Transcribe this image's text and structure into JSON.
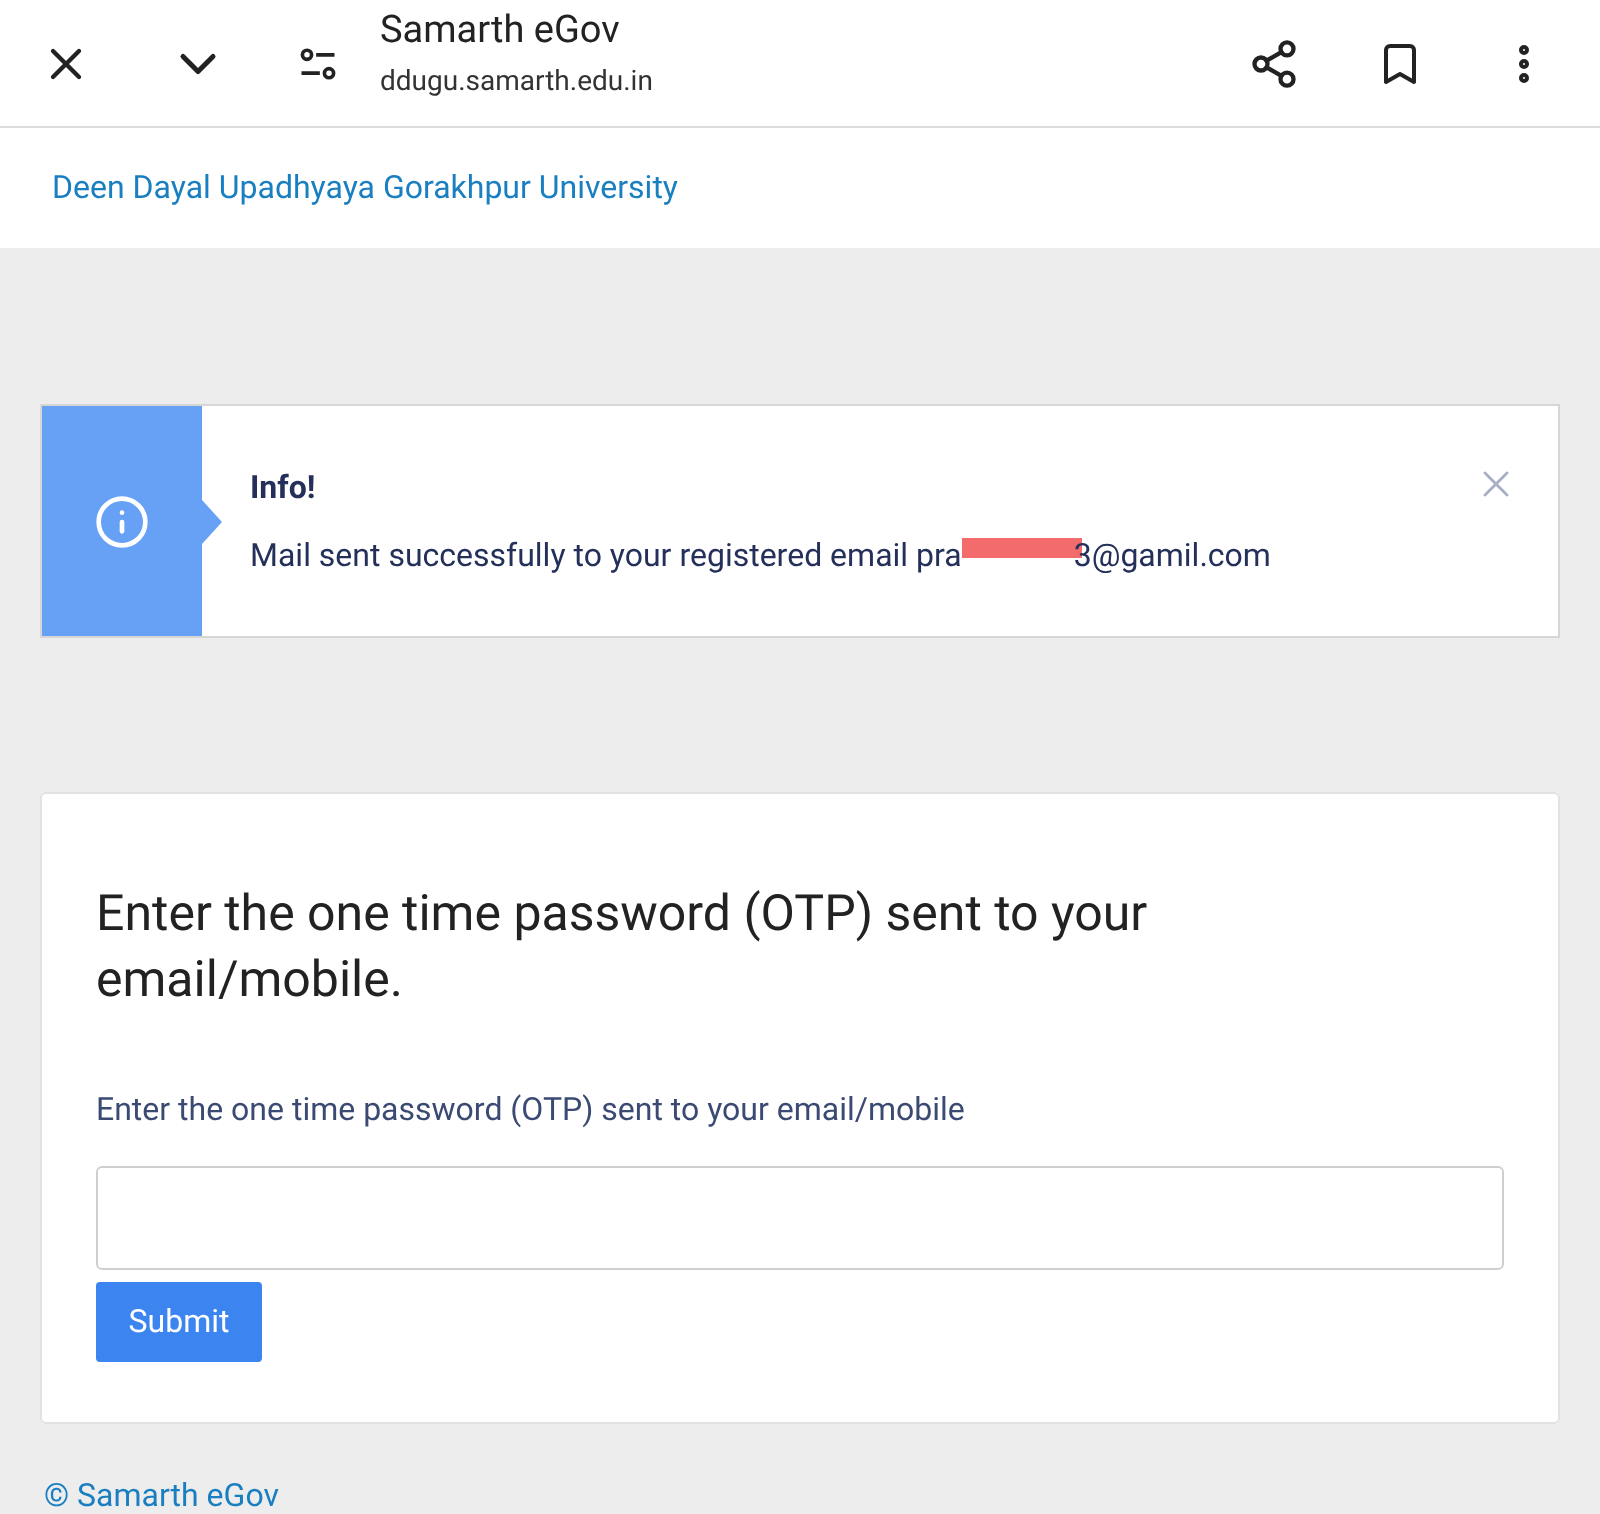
{
  "browser_bar": {
    "title": "Samarth eGov",
    "url": "ddugu.samarth.edu.in"
  },
  "header": {
    "link": "Deen Dayal Upadhyaya Gorakhpur University"
  },
  "alert": {
    "title": "Info!",
    "message_start": "Mail sent successfully to your registered email pra",
    "message_end": "3@gamil.com"
  },
  "otp_card": {
    "heading": "Enter the one time password (OTP) sent to your email/mobile.",
    "field_label": "Enter the one time password (OTP) sent to your email/mobile",
    "submit": "Submit"
  },
  "footer": {
    "text": "© Samarth eGov"
  }
}
